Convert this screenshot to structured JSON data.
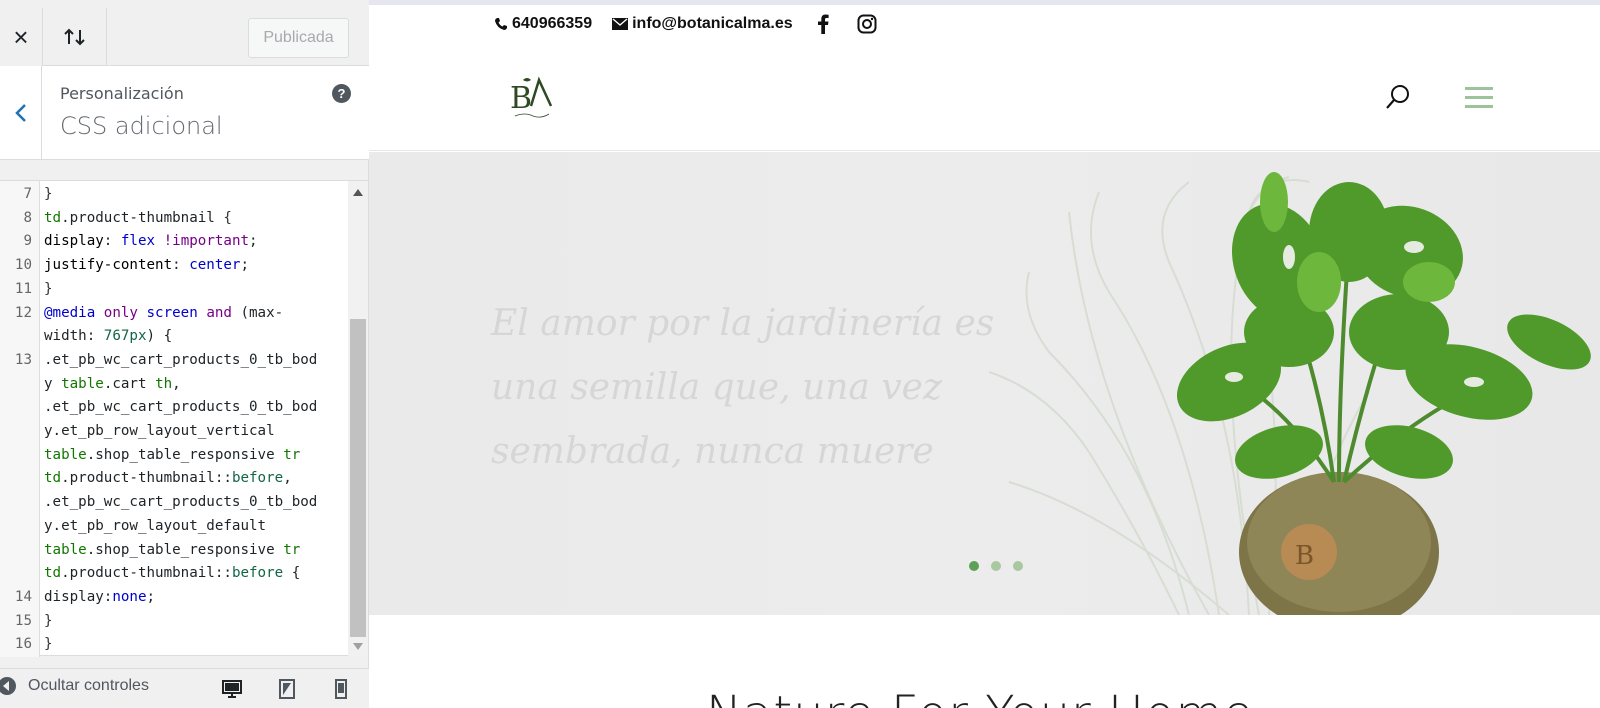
{
  "customizer": {
    "close_label": "×",
    "publish_label": "Publicada",
    "breadcrumb": "Personalización",
    "section_title": "CSS adicional",
    "help_label": "?",
    "hide_controls_label": "Ocultar controles"
  },
  "code_lines": [
    {
      "n": "7",
      "html": "<span class='p'>}</span>"
    },
    {
      "n": "8",
      "html": "<span class='t'>td</span>.product-thumbnail <span class='p'>{</span>"
    },
    {
      "n": "9",
      "html": "<span class='a'>display</span>: <span class='d'>flex</span> <span class='k'>!important</span>;"
    },
    {
      "n": "10",
      "html": "<span class='a'>justify-content</span>: <span class='d'>center</span>;"
    },
    {
      "n": "11",
      "html": "<span class='p'>}</span>"
    },
    {
      "n": "12",
      "html": "<span class='d'>@media</span> <span class='k'>only</span> <span class='d'>screen</span> <span class='k'>and</span> (max-"
    },
    {
      "n": "",
      "html": "width: <span class='n'>767px</span>) {"
    },
    {
      "n": "13",
      "html": ".et_pb_wc_cart_products_0_tb_bod"
    },
    {
      "n": "",
      "html": "y <span class='t'>table</span>.cart <span class='t'>th</span>,"
    },
    {
      "n": "",
      "html": ".et_pb_wc_cart_products_0_tb_bod"
    },
    {
      "n": "",
      "html": "y.et_pb_row_layout_vertical"
    },
    {
      "n": "",
      "html": "<span class='t'>table</span>.shop_table_responsive <span class='t'>tr</span>"
    },
    {
      "n": "",
      "html": "<span class='t'>td</span>.product-thumbnail::<span class='n'>before</span>,"
    },
    {
      "n": "",
      "html": ".et_pb_wc_cart_products_0_tb_bod"
    },
    {
      "n": "",
      "html": "y.et_pb_row_layout_default"
    },
    {
      "n": "",
      "html": "<span class='t'>table</span>.shop_table_responsive <span class='t'>tr</span>"
    },
    {
      "n": "",
      "html": "<span class='t'>td</span>.product-thumbnail::<span class='n'>before</span> {"
    },
    {
      "n": "14",
      "html": "display:<span class='d'>none</span>;"
    },
    {
      "n": "15",
      "html": "<span class='p'>}</span>"
    },
    {
      "n": "16",
      "html": "<span class='p'>}</span>"
    }
  ],
  "site": {
    "phone": "640966359",
    "email": "info@botanicalma.es",
    "hero_quote": "El amor por la jardinería es una semilla que, una vez sembrada, nunca muere",
    "section_title": "Nature For Your Home",
    "slider_dots": 3,
    "active_dot": 0,
    "accent_color": "#9cc49a"
  },
  "icons": {
    "phone": "phone-icon",
    "email": "envelope-icon",
    "facebook": "facebook-icon",
    "instagram": "instagram-icon",
    "search": "search-icon",
    "menu": "hamburger-menu-icon"
  }
}
